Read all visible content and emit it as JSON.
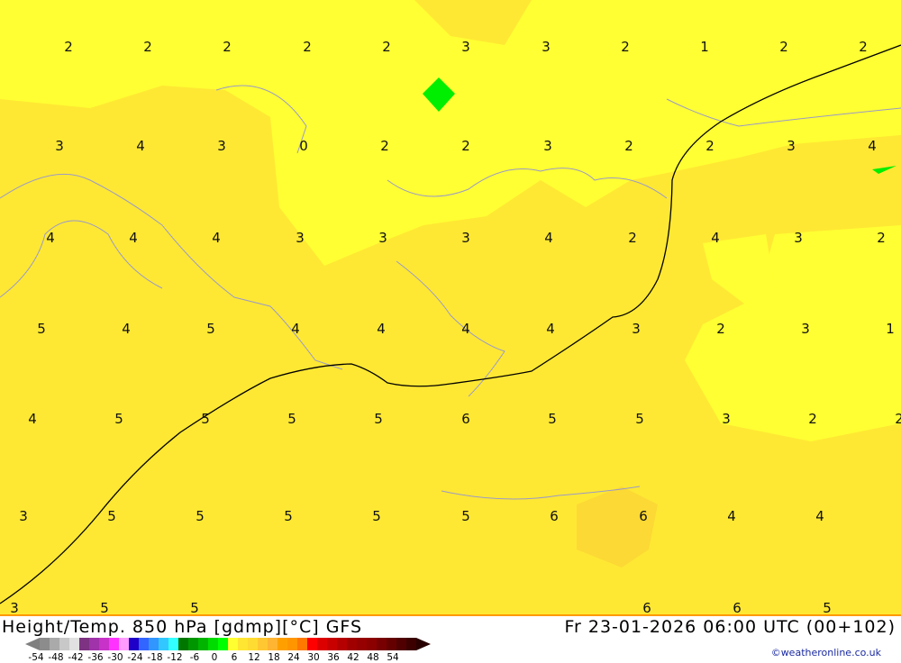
{
  "map": {
    "colors": {
      "bright_yellow": "#ffff33",
      "dark_yellow": "#ffe833",
      "darker_yellow": "#fcd935",
      "green": "#00ee00",
      "isotherm": "#000000",
      "coast": "#9a9ac8"
    },
    "labels": [
      [
        "2",
        "2",
        "2",
        "2",
        "2",
        "3",
        "3",
        "2",
        "1",
        "2",
        "2"
      ],
      [
        "3",
        "4",
        "3",
        "0",
        "2",
        "2",
        "3",
        "2",
        "2",
        "3",
        "4"
      ],
      [
        "4",
        "4",
        "4",
        "3",
        "3",
        "3",
        "4",
        "2",
        "4",
        "3",
        "2"
      ],
      [
        "5",
        "4",
        "5",
        "4",
        "4",
        "4",
        "4",
        "3",
        "2",
        "3",
        "1"
      ],
      [
        "4",
        "5",
        "5",
        "5",
        "5",
        "6",
        "5",
        "5",
        "3",
        "2",
        "2"
      ],
      [
        "3",
        "5",
        "5",
        "5",
        "5",
        "5",
        "6",
        "6",
        "4",
        "4"
      ],
      [
        "3",
        "5",
        "5",
        "6",
        "6",
        "5"
      ]
    ]
  },
  "footer": {
    "title": "Height/Temp. 850 hPa [gdmp][°C] GFS",
    "datetime": "Fr 23-01-2026 06:00 UTC (00+102)",
    "credit": "©weatheronline.co.uk",
    "colorbar": {
      "ticks": [
        "-54",
        "-48",
        "-42",
        "-36",
        "-30",
        "-24",
        "-18",
        "-12",
        "-6",
        "0",
        "6",
        "12",
        "18",
        "24",
        "30",
        "36",
        "42",
        "48",
        "54"
      ],
      "colors": [
        "#8c8c8c",
        "#aaaaaa",
        "#c8c8c8",
        "#e1e1e1",
        "#7d3282",
        "#a032aa",
        "#c832c8",
        "#ff32ff",
        "#ff9bff",
        "#1e00c8",
        "#3264ff",
        "#3296ff",
        "#32c8ff",
        "#32ffff",
        "#007800",
        "#009600",
        "#00b400",
        "#00dc00",
        "#00ff00",
        "#ffff32",
        "#ffe632",
        "#ffdc32",
        "#ffc832",
        "#ffb432",
        "#ffa000",
        "#ff9600",
        "#ff7800",
        "#ff0000",
        "#dc0000",
        "#c80000",
        "#b40000",
        "#a00000",
        "#960000",
        "#8c0000",
        "#780000",
        "#640000",
        "#500000",
        "#3c0000"
      ]
    }
  }
}
